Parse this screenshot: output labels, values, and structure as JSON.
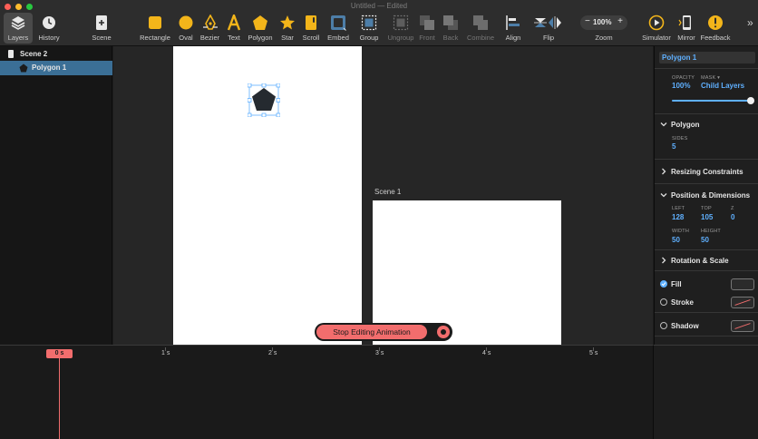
{
  "window": {
    "title": "Untitled — Edited"
  },
  "toolbar": {
    "layers": "Layers",
    "history": "History",
    "scene": "Scene",
    "rectangle": "Rectangle",
    "oval": "Oval",
    "bezier": "Bezier",
    "text": "Text",
    "polygon": "Polygon",
    "star": "Star",
    "scroll": "Scroll",
    "embed": "Embed",
    "group": "Group",
    "ungroup": "Ungroup",
    "front": "Front",
    "back": "Back",
    "combine": "Combine",
    "align": "Align",
    "flip": "Flip",
    "zoom_label": "Zoom",
    "zoom_value": "100%",
    "simulator": "Simulator",
    "mirror": "Mirror",
    "feedback": "Feedback"
  },
  "layers": [
    {
      "name": "Scene 2",
      "selected": false
    },
    {
      "name": "Polygon 1",
      "selected": true
    }
  ],
  "canvas": {
    "scene1_label": "Scene 1",
    "stop_editing": "Stop Editing Animation"
  },
  "inspector": {
    "name_field": "Polygon 1",
    "opacity_label": "OPACITY",
    "opacity_value": "100%",
    "mask_label": "MASK",
    "mask_value": "Child Layers",
    "polygon_title": "Polygon",
    "sides_label": "SIDES",
    "sides_value": "5",
    "resizing_title": "Resizing Constraints",
    "position_title": "Position & Dimensions",
    "left_label": "LEFT",
    "left_value": "128",
    "top_label": "TOP",
    "top_value": "105",
    "z_label": "Z",
    "z_value": "0",
    "width_label": "WIDTH",
    "width_value": "50",
    "height_label": "HEIGHT",
    "height_value": "50",
    "rotation_title": "Rotation & Scale",
    "fill_label": "Fill",
    "stroke_label": "Stroke",
    "shadow_label": "Shadow"
  },
  "timeline": {
    "playhead": "0 s",
    "ticks": [
      "1 s",
      "2 s",
      "3 s",
      "4 s",
      "5 s"
    ]
  },
  "colors": {
    "accent": "#5fb0ff",
    "record": "#f26d6d",
    "toolbar_yellow": "#f3b51a",
    "selection": "#3b6f96"
  }
}
